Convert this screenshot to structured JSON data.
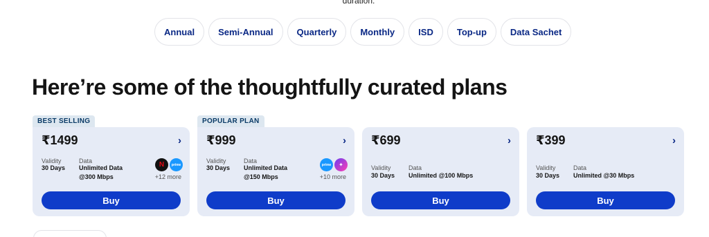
{
  "top_text": "duration.",
  "filters": [
    "Annual",
    "Semi-Annual",
    "Quarterly",
    "Monthly",
    "ISD",
    "Top-up",
    "Data Sachet"
  ],
  "heading": "Here’re some of the thoughtfully curated plans",
  "plans": [
    {
      "tag": "BEST SELLING",
      "price": "₹1499",
      "validity_label": "Validity",
      "validity": "30 Days",
      "data_label": "Data",
      "data_line1": "Unlimited Data",
      "data_line2": "@300 Mbps",
      "ott": [
        "netflix-icon",
        "prime-video-icon"
      ],
      "more": "+12 more",
      "buy": "Buy"
    },
    {
      "tag": "POPULAR PLAN",
      "price": "₹999",
      "validity_label": "Validity",
      "validity": "30 Days",
      "data_label": "Data",
      "data_line1": "Unlimited Data",
      "data_line2": "@150 Mbps",
      "ott": [
        "prime-video-icon",
        "streaming-app-icon"
      ],
      "more": "+10 more",
      "buy": "Buy"
    },
    {
      "tag": "",
      "price": "₹699",
      "validity_label": "Validity",
      "validity": "30 Days",
      "data_label": "Data",
      "data_line1": "Unlimited @100 Mbps",
      "buy": "Buy"
    },
    {
      "tag": "",
      "price": "₹399",
      "validity_label": "Validity",
      "validity": "30 Days",
      "data_label": "Data",
      "data_line1": "Unlimited @30 Mbps",
      "buy": "Buy"
    }
  ],
  "colors": {
    "accent": "#0f3cc9",
    "card_bg": "#e6ebf6",
    "tag_bg": "#dde7f0",
    "chip_text": "#0a2885"
  }
}
